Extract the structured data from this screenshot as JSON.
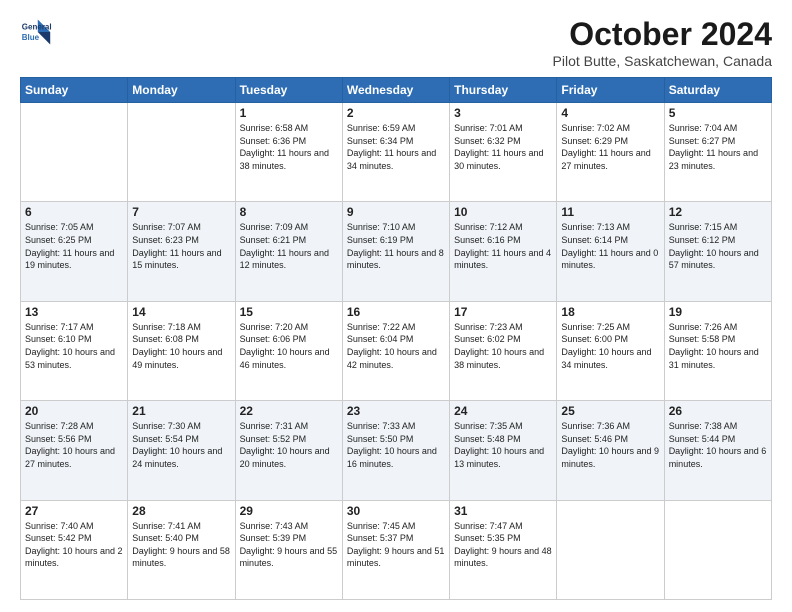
{
  "logo": {
    "line1": "General",
    "line2": "Blue"
  },
  "title": "October 2024",
  "subtitle": "Pilot Butte, Saskatchewan, Canada",
  "weekdays": [
    "Sunday",
    "Monday",
    "Tuesday",
    "Wednesday",
    "Thursday",
    "Friday",
    "Saturday"
  ],
  "weeks": [
    [
      {
        "day": "",
        "info": ""
      },
      {
        "day": "",
        "info": ""
      },
      {
        "day": "1",
        "info": "Sunrise: 6:58 AM\nSunset: 6:36 PM\nDaylight: 11 hours and 38 minutes."
      },
      {
        "day": "2",
        "info": "Sunrise: 6:59 AM\nSunset: 6:34 PM\nDaylight: 11 hours and 34 minutes."
      },
      {
        "day": "3",
        "info": "Sunrise: 7:01 AM\nSunset: 6:32 PM\nDaylight: 11 hours and 30 minutes."
      },
      {
        "day": "4",
        "info": "Sunrise: 7:02 AM\nSunset: 6:29 PM\nDaylight: 11 hours and 27 minutes."
      },
      {
        "day": "5",
        "info": "Sunrise: 7:04 AM\nSunset: 6:27 PM\nDaylight: 11 hours and 23 minutes."
      }
    ],
    [
      {
        "day": "6",
        "info": "Sunrise: 7:05 AM\nSunset: 6:25 PM\nDaylight: 11 hours and 19 minutes."
      },
      {
        "day": "7",
        "info": "Sunrise: 7:07 AM\nSunset: 6:23 PM\nDaylight: 11 hours and 15 minutes."
      },
      {
        "day": "8",
        "info": "Sunrise: 7:09 AM\nSunset: 6:21 PM\nDaylight: 11 hours and 12 minutes."
      },
      {
        "day": "9",
        "info": "Sunrise: 7:10 AM\nSunset: 6:19 PM\nDaylight: 11 hours and 8 minutes."
      },
      {
        "day": "10",
        "info": "Sunrise: 7:12 AM\nSunset: 6:16 PM\nDaylight: 11 hours and 4 minutes."
      },
      {
        "day": "11",
        "info": "Sunrise: 7:13 AM\nSunset: 6:14 PM\nDaylight: 11 hours and 0 minutes."
      },
      {
        "day": "12",
        "info": "Sunrise: 7:15 AM\nSunset: 6:12 PM\nDaylight: 10 hours and 57 minutes."
      }
    ],
    [
      {
        "day": "13",
        "info": "Sunrise: 7:17 AM\nSunset: 6:10 PM\nDaylight: 10 hours and 53 minutes."
      },
      {
        "day": "14",
        "info": "Sunrise: 7:18 AM\nSunset: 6:08 PM\nDaylight: 10 hours and 49 minutes."
      },
      {
        "day": "15",
        "info": "Sunrise: 7:20 AM\nSunset: 6:06 PM\nDaylight: 10 hours and 46 minutes."
      },
      {
        "day": "16",
        "info": "Sunrise: 7:22 AM\nSunset: 6:04 PM\nDaylight: 10 hours and 42 minutes."
      },
      {
        "day": "17",
        "info": "Sunrise: 7:23 AM\nSunset: 6:02 PM\nDaylight: 10 hours and 38 minutes."
      },
      {
        "day": "18",
        "info": "Sunrise: 7:25 AM\nSunset: 6:00 PM\nDaylight: 10 hours and 34 minutes."
      },
      {
        "day": "19",
        "info": "Sunrise: 7:26 AM\nSunset: 5:58 PM\nDaylight: 10 hours and 31 minutes."
      }
    ],
    [
      {
        "day": "20",
        "info": "Sunrise: 7:28 AM\nSunset: 5:56 PM\nDaylight: 10 hours and 27 minutes."
      },
      {
        "day": "21",
        "info": "Sunrise: 7:30 AM\nSunset: 5:54 PM\nDaylight: 10 hours and 24 minutes."
      },
      {
        "day": "22",
        "info": "Sunrise: 7:31 AM\nSunset: 5:52 PM\nDaylight: 10 hours and 20 minutes."
      },
      {
        "day": "23",
        "info": "Sunrise: 7:33 AM\nSunset: 5:50 PM\nDaylight: 10 hours and 16 minutes."
      },
      {
        "day": "24",
        "info": "Sunrise: 7:35 AM\nSunset: 5:48 PM\nDaylight: 10 hours and 13 minutes."
      },
      {
        "day": "25",
        "info": "Sunrise: 7:36 AM\nSunset: 5:46 PM\nDaylight: 10 hours and 9 minutes."
      },
      {
        "day": "26",
        "info": "Sunrise: 7:38 AM\nSunset: 5:44 PM\nDaylight: 10 hours and 6 minutes."
      }
    ],
    [
      {
        "day": "27",
        "info": "Sunrise: 7:40 AM\nSunset: 5:42 PM\nDaylight: 10 hours and 2 minutes."
      },
      {
        "day": "28",
        "info": "Sunrise: 7:41 AM\nSunset: 5:40 PM\nDaylight: 9 hours and 58 minutes."
      },
      {
        "day": "29",
        "info": "Sunrise: 7:43 AM\nSunset: 5:39 PM\nDaylight: 9 hours and 55 minutes."
      },
      {
        "day": "30",
        "info": "Sunrise: 7:45 AM\nSunset: 5:37 PM\nDaylight: 9 hours and 51 minutes."
      },
      {
        "day": "31",
        "info": "Sunrise: 7:47 AM\nSunset: 5:35 PM\nDaylight: 9 hours and 48 minutes."
      },
      {
        "day": "",
        "info": ""
      },
      {
        "day": "",
        "info": ""
      }
    ]
  ]
}
